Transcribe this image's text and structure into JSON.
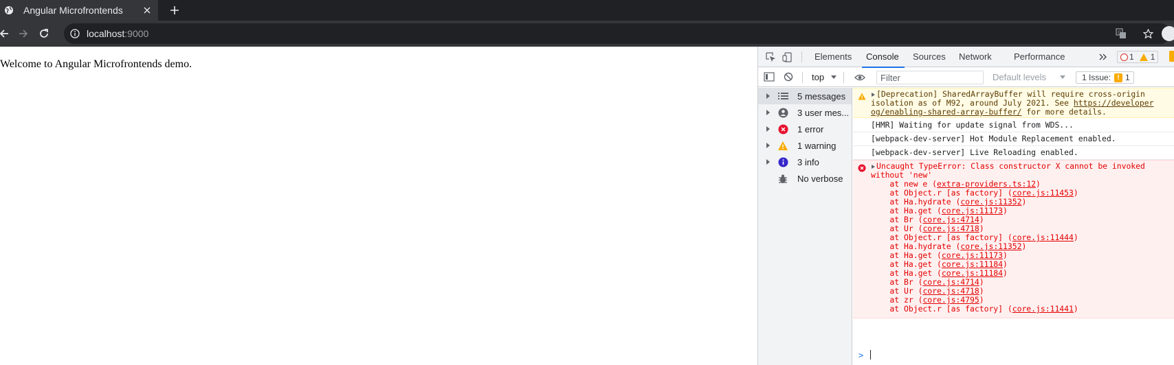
{
  "browser": {
    "tab": {
      "title": "Angular Microfrontends"
    },
    "omnibox": {
      "host": "localhost",
      "port": ":9000"
    }
  },
  "page": {
    "welcome_text": "Welcome to Angular Microfrontends demo."
  },
  "devtools": {
    "tabs": [
      "Elements",
      "Console",
      "Sources",
      "Network",
      "Performance"
    ],
    "active_tab": "Console",
    "error_count": "1",
    "warning_count": "1",
    "context": "top",
    "filter_placeholder": "Filter",
    "levels_label": "Default levels",
    "issues_label": "1 Issue:",
    "issues_count": "1",
    "sidebar": [
      {
        "label": "5 messages",
        "icon": "list-icon"
      },
      {
        "label": "3 user mes...",
        "icon": "user-icon"
      },
      {
        "label": "1 error",
        "icon": "error-icon"
      },
      {
        "label": "1 warning",
        "icon": "warning-icon"
      },
      {
        "label": "3 info",
        "icon": "info-icon"
      },
      {
        "label": "No verbose",
        "icon": "bug-icon"
      }
    ],
    "console": {
      "deprecation": {
        "l1": "[Deprecation] SharedArrayBuffer will require cross-origin",
        "l2a": "isolation as of M92, around July 2021. See ",
        "l2b": "https://developer",
        "l3a": "og/enabling-shared-array-buffer/",
        "l3b": " for more details."
      },
      "plain": [
        "[HMR] Waiting for update signal from WDS...",
        "[webpack-dev-server] Hot Module Replacement enabled.",
        "[webpack-dev-server] Live Reloading enabled."
      ],
      "error": {
        "l1": "Uncaught TypeError: Class constructor X cannot be invoked",
        "l2": "without 'new'",
        "trace": [
          {
            "fn": "    at new e (",
            "src": "extra-providers.ts:12",
            "end": ")"
          },
          {
            "fn": "    at Object.r [as factory] (",
            "src": "core.js:11453",
            "end": ")"
          },
          {
            "fn": "    at Ha.hydrate (",
            "src": "core.js:11352",
            "end": ")"
          },
          {
            "fn": "    at Ha.get (",
            "src": "core.js:11173",
            "end": ")"
          },
          {
            "fn": "    at Br (",
            "src": "core.js:4714",
            "end": ")"
          },
          {
            "fn": "    at Ur (",
            "src": "core.js:4718",
            "end": ")"
          },
          {
            "fn": "    at Object.r [as factory] (",
            "src": "core.js:11444",
            "end": ")"
          },
          {
            "fn": "    at Ha.hydrate (",
            "src": "core.js:11352",
            "end": ")"
          },
          {
            "fn": "    at Ha.get (",
            "src": "core.js:11173",
            "end": ")"
          },
          {
            "fn": "    at Ha.get (",
            "src": "core.js:11184",
            "end": ")"
          },
          {
            "fn": "    at Ha.get (",
            "src": "core.js:11184",
            "end": ")"
          },
          {
            "fn": "    at Br (",
            "src": "core.js:4714",
            "end": ")"
          },
          {
            "fn": "    at Ur (",
            "src": "core.js:4718",
            "end": ")"
          },
          {
            "fn": "    at zr (",
            "src": "core.js:4795",
            "end": ")"
          },
          {
            "fn": "    at Object.r [as factory] (",
            "src": "core.js:11441",
            "end": ")"
          }
        ]
      },
      "prompt": ">"
    }
  }
}
